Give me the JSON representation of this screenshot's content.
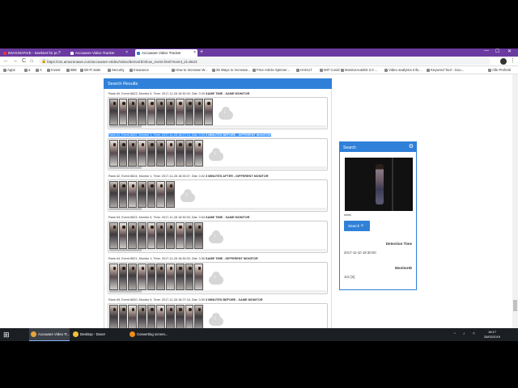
{
  "browser": {
    "tabs": [
      {
        "label": "IMAGINATIVE - Seeknet for pr...",
        "active": false
      },
      {
        "label": "Accuware Video Tracker",
        "active": false
      },
      {
        "label": "Accuware Video Tracker",
        "active": true
      }
    ],
    "new_tab": "+",
    "close_glyph": "×",
    "window_controls": {
      "minimize": "—",
      "maximize": "☐",
      "close": "✕"
    },
    "nav": {
      "back": "←",
      "forward": "→",
      "reload": "C",
      "home": "⌂"
    },
    "lock_glyph": "🔒",
    "url": "https://vt1.amazonaws.com/accuware-vt/dev/video/demo/rb/show_event.html?event_id=8623",
    "kebab": "⋮",
    "bookmarks": [
      "Apps",
      "a",
      "A",
      "Invest",
      "IBM",
      "Wi-Fi stats",
      "Security",
      "Insurance",
      "How to Increase W...",
      "25 Ways to Increase...",
      "Free Article Spinner...",
      "HAKU.f",
      "MIT Covid",
      "MonitorAutolist 2.0 ...",
      "Video analytics Info...",
      "Keyword Tool - Goo...",
      "Alle Preferiti"
    ]
  },
  "results": {
    "header": "Search Results",
    "ranks": [
      {
        "title": "Rank #0, Event 8623, Monitor 5, Time: 2017-11-28 18:30:00, Dist: 0.00",
        "tag": "SAME TIME - SAME MONITOR",
        "thumb_count": 11,
        "selected": false
      },
      {
        "title": "Rank #1, Event 8622, Monitor 1, Time: 2017-11-28 18:27:13, Dist: 0.50",
        "tag": "3 MINUTES BEFORE - DIFFERENT MONITOR",
        "thumb_count": 10,
        "selected": true
      },
      {
        "title": "Rank #2, Event 8624, Monitor 1, Time: 2017-11-28 18:33:07, Dist: 0.52",
        "tag": "3 MINUTES AFTER - DIFFERENT MONITOR",
        "thumb_count": 7,
        "selected": false
      },
      {
        "title": "Rank #3, Event 8623, Monitor 5, Time: 2017-11-28 18:30:00, Dist: 0.54",
        "tag": "SAME TIME - SAME MONITOR",
        "thumb_count": 10,
        "selected": false
      },
      {
        "title": "Rank #4, Event 8621, Monitor 1, Time: 2017-11-28 18:30:00, Dist: 0.56",
        "tag": "SAME TIME - DIFFERENT MONITOR",
        "thumb_count": 10,
        "selected": false
      },
      {
        "title": "Rank #5, Event 8620, Monitor 5, Time: 2017-11-28 18:27:16, Dist: 0.59",
        "tag": "3 MINUTES BEFORE - SAME MONITOR",
        "thumb_count": 10,
        "selected": false
      }
    ]
  },
  "search_panel": {
    "title": "Search",
    "gear_glyph": "⚙",
    "query_label": "show",
    "search_button": "Search",
    "search_glyph": "🔍",
    "detection_time_label": "Detection Time",
    "detection_time_value": "2017-11-10 18:30:00",
    "monitor_id_label": "MonitorID",
    "monitor_id_value": "101 [5]"
  },
  "taskbar": {
    "start_glyph": "⊞",
    "apps": [
      {
        "label": "Accuware Video Tr...",
        "color": "#e8a33d",
        "active": true
      },
      {
        "label": "Desktop - Dover",
        "color": "#f0c040",
        "active": false
      },
      {
        "label": "Converting screen...",
        "color": "#f08c1a",
        "active": false
      }
    ],
    "time": "18:17",
    "date": "28/02/2019"
  }
}
